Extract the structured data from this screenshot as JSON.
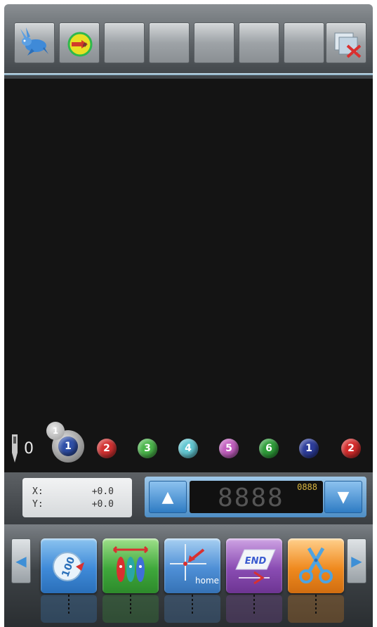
{
  "toolbar": {
    "buttons": [
      {
        "name": "rabbit-icon"
      },
      {
        "name": "speed-icon"
      },
      {
        "name": "empty"
      },
      {
        "name": "empty"
      },
      {
        "name": "empty"
      },
      {
        "name": "empty"
      },
      {
        "name": "empty"
      },
      {
        "name": "close-pattern-icon"
      }
    ]
  },
  "needles": {
    "needle_count": "0",
    "current_badge": "1",
    "items": [
      {
        "label": "1",
        "color": "#2f4fa8"
      },
      {
        "label": "2",
        "color": "#d23232"
      },
      {
        "label": "3",
        "color": "#4bb64b"
      },
      {
        "label": "4",
        "color": "#62c7d2"
      },
      {
        "label": "5",
        "color": "#c25fbf"
      },
      {
        "label": "6",
        "color": "#2f9e3a"
      },
      {
        "label": "1",
        "color": "#2d3d9b"
      },
      {
        "label": "2",
        "color": "#d42c2c"
      }
    ]
  },
  "status": {
    "x_label": "X:",
    "x_value": "+0.0",
    "y_label": "Y:",
    "y_value": "+0.0",
    "counter_main": "8888",
    "counter_small": "0888",
    "up_label": "▲",
    "down_label": "▼"
  },
  "function_bar": {
    "left_arrow": "◀",
    "right_arrow": "▶",
    "buttons": [
      {
        "name": "set-100-icon",
        "color": "#3f8ad8",
        "text": "100"
      },
      {
        "name": "needle-select-icon",
        "color": "#3fa83c"
      },
      {
        "name": "home-icon",
        "color": "#4e8fd6",
        "text": "home"
      },
      {
        "name": "end-icon",
        "color": "#8a4cb3",
        "text": "END"
      },
      {
        "name": "trim-scissors-icon",
        "color": "#ef8a1f"
      }
    ]
  }
}
